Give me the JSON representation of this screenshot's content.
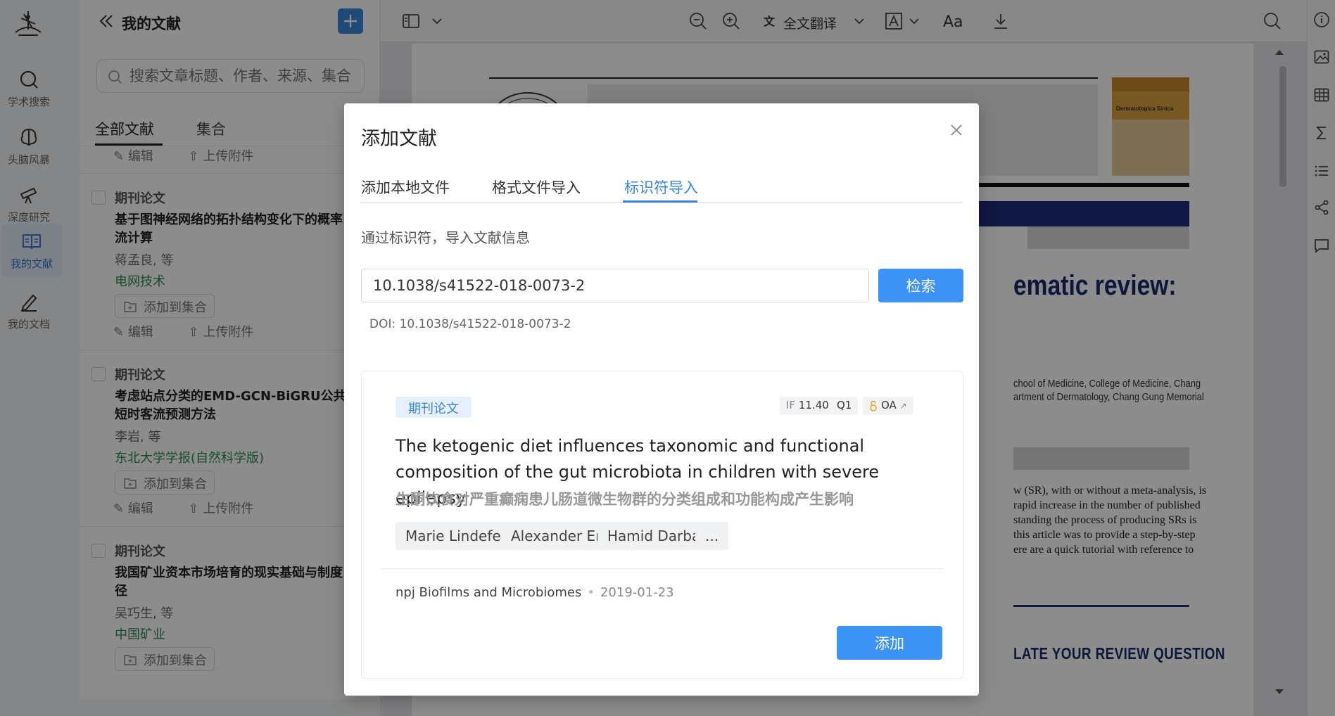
{
  "nav": {
    "items": [
      {
        "label": "学术搜索"
      },
      {
        "label": "头脑风暴"
      },
      {
        "label": "深度研究"
      },
      {
        "label": "我的文献"
      },
      {
        "label": "我的文档"
      }
    ]
  },
  "library": {
    "title": "我的文献",
    "search_placeholder": "搜索文章标题、作者、来源、集合",
    "tabs": [
      {
        "label": "全部文献"
      },
      {
        "label": "集合"
      }
    ],
    "edit_label": "编辑",
    "upload_label": "上传附件",
    "add_collection_label": "添加到集合",
    "items": [
      {
        "type": "期刊论文",
        "title_line1": "基于图神经网络的拓扑结构变化下的概率",
        "title_line2": "流计算",
        "authors": "蒋孟良, 等",
        "source": "电网技术"
      },
      {
        "type": "期刊论文",
        "title_line1": "考虑站点分类的EMD-GCN-BiGRU公共交",
        "title_line2": "短时客流预测方法",
        "authors": "李岩, 等",
        "source": "东北大学学报(自然科学版)"
      },
      {
        "type": "期刊论文",
        "title_line1": "我国矿业资本市场培育的现实基础与制度",
        "title_line2": "径",
        "authors": "吴巧生, 等",
        "source": "中国矿业"
      }
    ]
  },
  "toolbar": {
    "translate_label": "全文翻译",
    "font_label": "Aa"
  },
  "document": {
    "review_title": "ematic review:",
    "affil_line1": "chool of Medicine, College of Medicine, Chang",
    "affil_line2": "artment of Dermatology, Chang Gung Memorial",
    "abstract_lines": [
      "w (SR), with or without a meta-analysis, is",
      "rapid increase in the number of published",
      "standing the process of producing SRs is",
      "this article was to provide a step-by-step",
      "ere are a quick tutorial with reference to"
    ],
    "section_heading": "LATE YOUR REVIEW QUESTION",
    "journal_cover_text": "Dermatologica Sinica"
  },
  "modal": {
    "title": "添加文献",
    "tabs": [
      {
        "label": "添加本地文件"
      },
      {
        "label": "格式文件导入"
      },
      {
        "label": "标识符导入"
      }
    ],
    "active_tab": "标识符导入",
    "description": "通过标识符，导入文献信息",
    "input_value": "10.1038/s41522-018-0073-2",
    "search_label": "检索",
    "doi_hint": "DOI: 10.1038/s41522-018-0073-2",
    "result": {
      "type": "期刊论文",
      "if_label": "IF",
      "if_value": "11.40",
      "quartile": "Q1",
      "oa_label": "OA",
      "title": "The ketogenic diet influences taxonomic and functional composition of the gut microbiota in children with severe epilepsy",
      "title_zh": "生酮饮食对严重癫痫患儿肠道微生物群的分类组成和功能构成产生影响",
      "authors": [
        "Marie Lindefeldt",
        "Alexander Eng",
        "Hamid Darban",
        "..."
      ],
      "journal": "npj Biofilms and Microbiomes",
      "date": "2019-01-23",
      "add_label": "添加"
    }
  },
  "colors": {
    "accent": "#3a85d8",
    "button": "#3d92f5",
    "source_green": "#2e8b57",
    "oa_orange": "#f39a2b"
  }
}
